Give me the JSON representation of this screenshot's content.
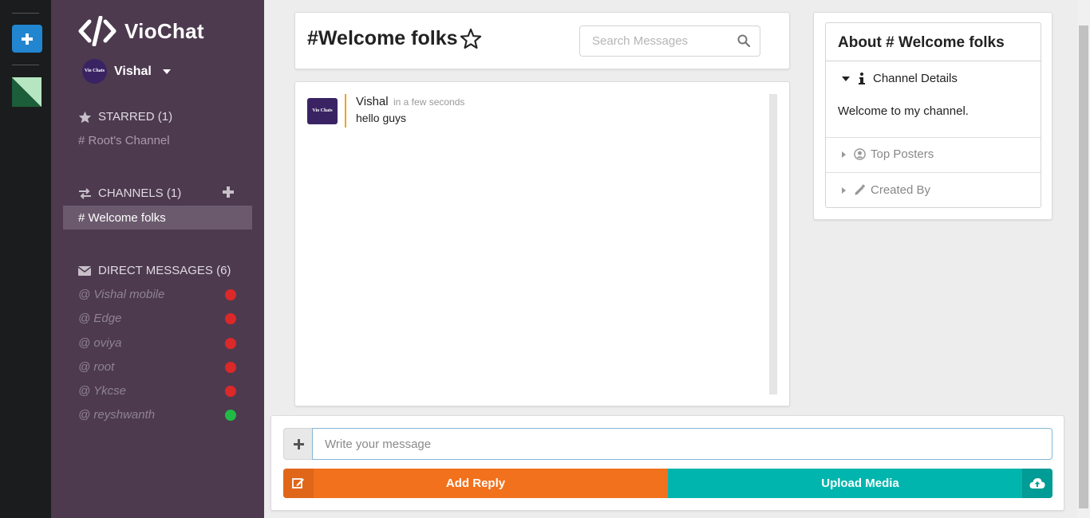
{
  "app": {
    "name": "VioChat"
  },
  "user": {
    "name": "Vishal",
    "avatar_text": "Vio Chats"
  },
  "sidebar": {
    "starred": {
      "label": "STARRED (1)",
      "items": [
        "# Root's Channel"
      ]
    },
    "channels": {
      "label": "CHANNELS (1)",
      "items": [
        "# Welcome folks"
      ]
    },
    "direct_messages": {
      "label": "DIRECT MESSAGES (6)",
      "items": [
        {
          "name": "@ Vishal mobile",
          "status": "offline"
        },
        {
          "name": "@ Edge",
          "status": "offline"
        },
        {
          "name": "@ oviya",
          "status": "offline"
        },
        {
          "name": "@ root",
          "status": "offline"
        },
        {
          "name": "@ Ykcse",
          "status": "offline"
        },
        {
          "name": "@ reyshwanth",
          "status": "online"
        }
      ]
    }
  },
  "channel": {
    "title": "#Welcome folks",
    "search_placeholder": "Search Messages"
  },
  "messages": [
    {
      "author": "Vishal",
      "time": "in a few seconds",
      "text": "hello guys",
      "avatar_text": "Vio Chats"
    }
  ],
  "about": {
    "title": "About # Welcome folks",
    "details_label": "Channel Details",
    "description": "Welcome to my channel.",
    "top_posters_label": "Top Posters",
    "created_by_label": "Created By"
  },
  "composer": {
    "placeholder": "Write your message",
    "reply_label": "Add Reply",
    "upload_label": "Upload Media"
  },
  "colors": {
    "sidebar_bg": "#4d3a4f",
    "rail_bg": "#1b1c1d",
    "rail_add": "#2185d0",
    "reply": "#f2711c",
    "upload": "#00b5ad",
    "offline_dot": "#db2828",
    "online_dot": "#21ba45",
    "message_accent": "#f2a218"
  },
  "icons": [
    "plus-icon",
    "code-icon",
    "caret-down-icon",
    "star-icon",
    "exchange-icon",
    "envelope-icon",
    "search-icon",
    "info-icon",
    "user-circle-icon",
    "pencil-icon",
    "edit-icon",
    "cloud-upload-icon"
  ]
}
